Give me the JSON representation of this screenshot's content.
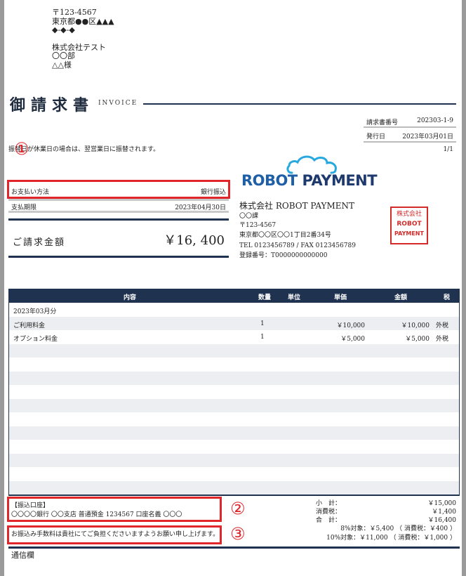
{
  "recipient": {
    "postal": "〒123-4567",
    "address1": "東京都●●区▲▲▲",
    "address2": "◆-◆-◆",
    "company": "株式会社テスト",
    "department": "〇〇部",
    "person": "△△様"
  },
  "title": {
    "main": "御請求書",
    "sub": "INVOICE"
  },
  "meta": {
    "invoice_no_label": "請求書番号",
    "invoice_no": "202303-1-9",
    "issue_date_label": "発行日",
    "issue_date": "2023年03月01日",
    "page": "1/1"
  },
  "notice": "振替日が休業日の場合は、翌営業日に振替されます。",
  "payment": {
    "method_label": "お支払い方法",
    "method_value": "銀行振込",
    "due_label": "支払期限",
    "due_value": "2023年04月30日",
    "amount_label": "ご請求金額",
    "amount_value": "￥16, 400"
  },
  "markers": {
    "m1": "①",
    "m2": "②",
    "m3": "③"
  },
  "issuer": {
    "logo_word1": "ROBOT",
    "logo_word2": "PAYMENT",
    "company": "株式会社 ROBOT PAYMENT",
    "person": "〇〇課",
    "postal": "〒123-4567",
    "address": "東京都〇〇区〇〇1丁目2番34号",
    "tel_fax": "TEL 0123456789 / FAX 0123456789",
    "reg_no": "登録番号：T0000000000000",
    "seal_lines": [
      "株式会社",
      "ROBOT",
      "PAYMENT"
    ]
  },
  "table": {
    "headers": [
      "内容",
      "数量",
      "単位",
      "単価",
      "金額",
      "税"
    ],
    "rows": [
      {
        "desc": "2023年03月分",
        "qty": "",
        "unit": "",
        "price": "",
        "amount": "",
        "tax": ""
      },
      {
        "desc": "ご利用料金",
        "qty": "1",
        "unit": "",
        "price": "￥10,000",
        "amount": "￥10,000",
        "tax": "外税"
      },
      {
        "desc": "オプション料金",
        "qty": "1",
        "unit": "",
        "price": "￥5,000",
        "amount": "￥5,000",
        "tax": "外税"
      }
    ]
  },
  "bank": {
    "title": "【振込口座】",
    "detail": "〇〇〇〇銀行 〇〇支店 普通預金 1234567 口座名義 〇〇〇"
  },
  "fee_note": "お振込み手数料は貴社にてご負担くださいますようお願い申し上げます。",
  "totals": {
    "subtotal_label": "小　計：",
    "subtotal": "￥15,000",
    "tax_label": "消費税：",
    "tax": "￥1,400",
    "total_label": "合　計：",
    "total": "￥16,400",
    "tax8": "8%対象：￥5,400 （ 消費税：￥400 ）",
    "tax10": "10%対象：￥11,000 （ 消費税：￥1,000 ）"
  },
  "notes_label": "通信欄",
  "colors": {
    "navy": "#1f3350",
    "accent_red": "#e0252b",
    "logo_blue": "#1e5fa8",
    "cloud": "#29a8e0"
  }
}
